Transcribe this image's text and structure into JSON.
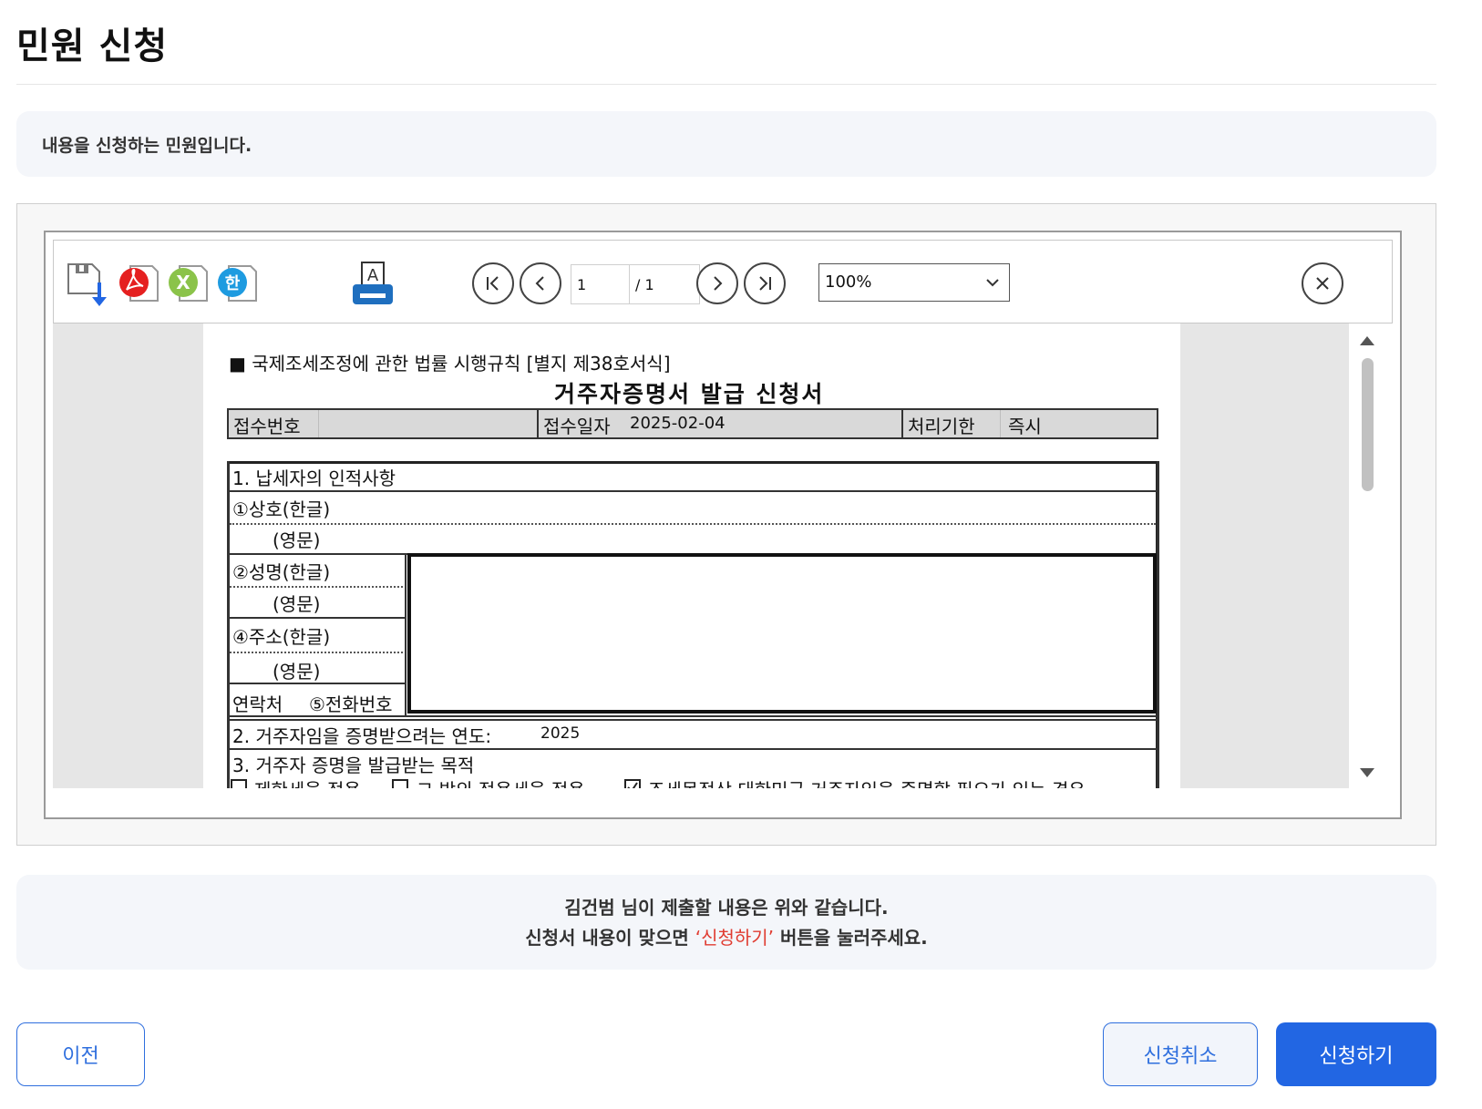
{
  "page": {
    "title": "민원 신청",
    "notice": "내용을 신청하는 민원입니다."
  },
  "viewer": {
    "toolbar": {
      "icons": [
        "save-icon",
        "pdf-icon",
        "excel-icon",
        "hwp-icon",
        "print-icon"
      ],
      "current_page": "1",
      "total_pages": "/ 1",
      "zoom": "100%"
    },
    "document": {
      "rule_ref": "■ 국제조세조정에 관한 법률 시행규칙 [별지 제38호서식]",
      "title": "거주자증명서 발급 신청서",
      "header": {
        "receipt_no_label": "접수번호",
        "receipt_date_label": "접수일자",
        "receipt_date": "2025-02-04",
        "deadline_label": "처리기한",
        "deadline": "즉시"
      },
      "sections": {
        "s1": "1. 납세자의 인적사항",
        "company_kr": "①상호(한글)",
        "company_en": "(영문)",
        "name_kr": "②성명(한글)",
        "name_en": "(영문)",
        "addr_kr": "④주소(한글)",
        "addr_en": "(영문)",
        "contact": "연락처",
        "phone": "⑤전화번호",
        "s2": "2. 거주자임을 증명받으려는 연도:",
        "s2_year": "2025",
        "s3": "3. 거주자 증명을 발급받는 목적",
        "purpose_1": "제한세율 적용",
        "purpose_2": "그 밖의 적용세율 적용",
        "purpose_3": "조세목적상 대한민국 거주자임을 증명할 필요가 있는 경우"
      }
    }
  },
  "confirm": {
    "line1": "김건범 님이 제출할 내용은 위와 같습니다.",
    "line2_pre": "신청서 내용이 맞으면 ",
    "line2_highlight": "‘신청하기’",
    "line2_post": " 버튼을 눌러주세요."
  },
  "buttons": {
    "prev": "이전",
    "cancel": "신청취소",
    "submit": "신청하기"
  },
  "colors": {
    "primary": "#2266e3",
    "highlight": "#e03c31",
    "panel_bg": "#f4f6fa"
  }
}
